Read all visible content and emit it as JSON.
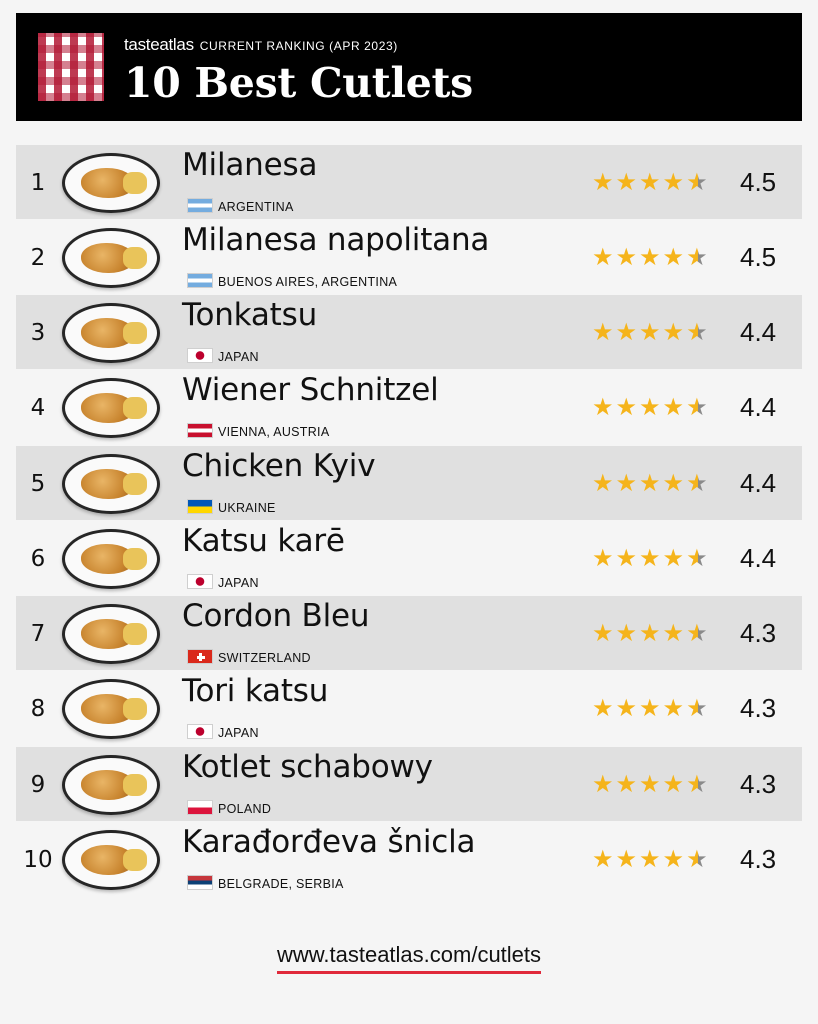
{
  "header": {
    "brand": "tasteatlas",
    "subtitle": "CURRENT RANKING (APR 2023)",
    "title": "10 Best Cutlets"
  },
  "colors": {
    "header_bg": "#000000",
    "row_shade": "#e0e0e0",
    "star": "#f5b41b",
    "star_empty": "#8a8a8a",
    "accent_underline": "#e0293b"
  },
  "items": [
    {
      "rank": "1",
      "name": "Milanesa",
      "origin": "ARGENTINA",
      "flag": "argentina-flag",
      "rating": "4.5",
      "stars": 4.5
    },
    {
      "rank": "2",
      "name": "Milanesa napolitana",
      "origin": "BUENOS AIRES, ARGENTINA",
      "flag": "argentina-flag",
      "rating": "4.5",
      "stars": 4.5
    },
    {
      "rank": "3",
      "name": "Tonkatsu",
      "origin": "JAPAN",
      "flag": "japan-flag",
      "rating": "4.4",
      "stars": 4.4
    },
    {
      "rank": "4",
      "name": "Wiener Schnitzel",
      "origin": "VIENNA, AUSTRIA",
      "flag": "austria-flag",
      "rating": "4.4",
      "stars": 4.4
    },
    {
      "rank": "5",
      "name": "Chicken Kyiv",
      "origin": "UKRAINE",
      "flag": "ukraine-flag",
      "rating": "4.4",
      "stars": 4.4
    },
    {
      "rank": "6",
      "name": "Katsu karē",
      "origin": "JAPAN",
      "flag": "japan-flag",
      "rating": "4.4",
      "stars": 4.4
    },
    {
      "rank": "7",
      "name": "Cordon Bleu",
      "origin": "SWITZERLAND",
      "flag": "switzerland-flag",
      "rating": "4.3",
      "stars": 4.3
    },
    {
      "rank": "8",
      "name": "Tori katsu",
      "origin": "JAPAN",
      "flag": "japan-flag",
      "rating": "4.3",
      "stars": 4.3
    },
    {
      "rank": "9",
      "name": "Kotlet schabowy",
      "origin": "POLAND",
      "flag": "poland-flag",
      "rating": "4.3",
      "stars": 4.3
    },
    {
      "rank": "10",
      "name": "Karađorđeva šnicla",
      "origin": "BELGRADE, SERBIA",
      "flag": "serbia-flag",
      "rating": "4.3",
      "stars": 4.3
    }
  ],
  "footer": {
    "url": "www.tasteatlas.com/cutlets"
  }
}
